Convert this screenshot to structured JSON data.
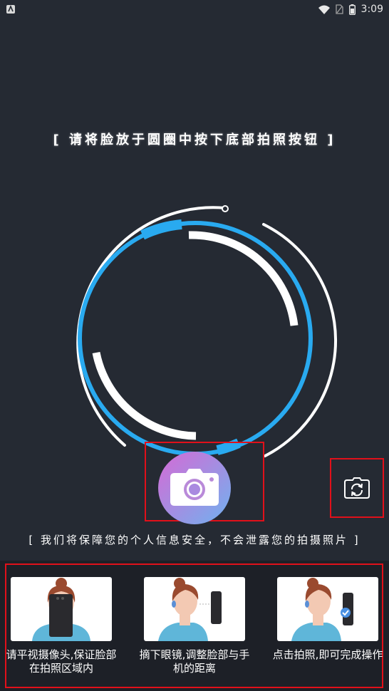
{
  "status_bar": {
    "time": "3:09",
    "icons": [
      "app-notification-icon",
      "wifi-icon",
      "no-sim-icon",
      "battery-icon"
    ]
  },
  "camera": {
    "instruction": "[ 请将脸放于圆圈中按下底部拍照按钮 ]",
    "privacy_note": "[ 我们将保障您的个人信息安全，不会泄露您的拍摄照片 ]",
    "shutter_icon": "camera-icon",
    "switch_icon": "camera-switch-icon"
  },
  "tips": [
    {
      "label": "请平视摄像头,保证脸部在拍照区域内",
      "icon": "face-front-illustration"
    },
    {
      "label": "摘下眼镜,调整脸部与手机的距离",
      "icon": "face-distance-illustration"
    },
    {
      "label": "点击拍照,即可完成操作",
      "icon": "face-done-illustration"
    }
  ],
  "colors": {
    "background": "#252a33",
    "ring_blue": "#29aaf0",
    "ring_white": "#ffffff",
    "highlight_red": "#e1101a"
  }
}
